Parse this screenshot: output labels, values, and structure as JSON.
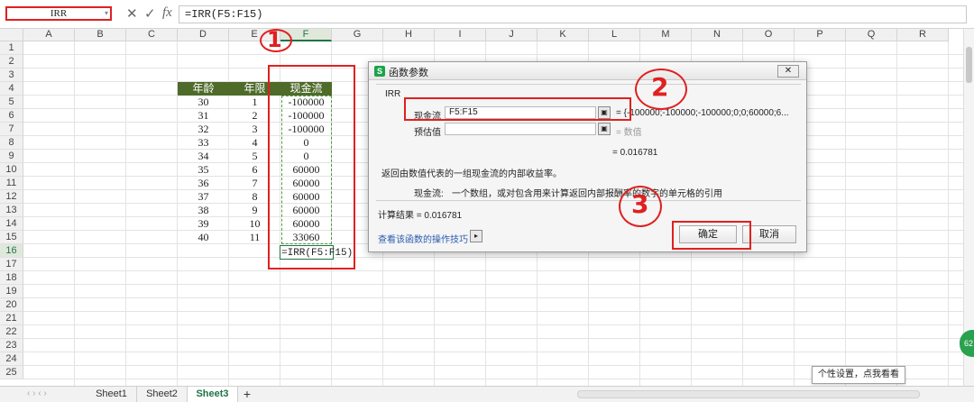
{
  "formula_bar": {
    "name_box": "IRR",
    "cancel_icon": "✕",
    "confirm_icon": "✓",
    "fx_label": "fx",
    "formula": "=IRR(F5:F15)"
  },
  "columns": [
    "A",
    "B",
    "C",
    "D",
    "E",
    "F",
    "G",
    "H",
    "I",
    "J",
    "K",
    "L",
    "M",
    "N",
    "O",
    "P",
    "Q",
    "R"
  ],
  "rows": [
    "1",
    "2",
    "3",
    "4",
    "5",
    "6",
    "7",
    "8",
    "9",
    "10",
    "11",
    "12",
    "13",
    "14",
    "15",
    "16",
    "17",
    "18",
    "19",
    "20",
    "21",
    "22",
    "23",
    "24",
    "25"
  ],
  "table": {
    "headers": [
      "年龄",
      "年限",
      "现金流"
    ],
    "data": [
      [
        "30",
        "1",
        "-100000"
      ],
      [
        "31",
        "2",
        "-100000"
      ],
      [
        "32",
        "3",
        "-100000"
      ],
      [
        "33",
        "4",
        "0"
      ],
      [
        "34",
        "5",
        "0"
      ],
      [
        "35",
        "6",
        "60000"
      ],
      [
        "36",
        "7",
        "60000"
      ],
      [
        "37",
        "8",
        "60000"
      ],
      [
        "38",
        "9",
        "60000"
      ],
      [
        "39",
        "10",
        "60000"
      ],
      [
        "40",
        "11",
        "33060"
      ]
    ],
    "formula_cell": "=IRR(F5:F15)"
  },
  "dialog": {
    "title": "函数参数",
    "logo": "S",
    "close": "✕",
    "function_name": "IRR",
    "arg1_label": "现金流",
    "arg1_value": "F5:F15",
    "arg1_result": "= {-100000;-100000;-100000;0;0;60000;6...",
    "arg2_label": "预估值",
    "arg2_value": "",
    "arg2_result": "= 数值",
    "eval_result": "= 0.016781",
    "description": "返回由数值代表的一组现金流的内部收益率。",
    "param_desc_label": "现金流:",
    "param_desc": "一个数组，或对包含用来计算返回内部报酬率的数字的单元格的引用",
    "calc_result": "计算结果 = 0.016781",
    "help_link": "查看该函数的操作技巧",
    "ok": "确定",
    "cancel": "取消"
  },
  "annotations": {
    "mark1": "1",
    "mark2": "2",
    "mark3": "3"
  },
  "sheets": [
    "Sheet1",
    "Sheet2",
    "Sheet3"
  ],
  "active_sheet": "Sheet3",
  "add_sheet": "+",
  "tooltip": "个性设置，点我看看",
  "badge": "62",
  "colors": {
    "header_green": "#4e6b2a",
    "annotation_red": "#e02020",
    "active_green": "#217346"
  }
}
